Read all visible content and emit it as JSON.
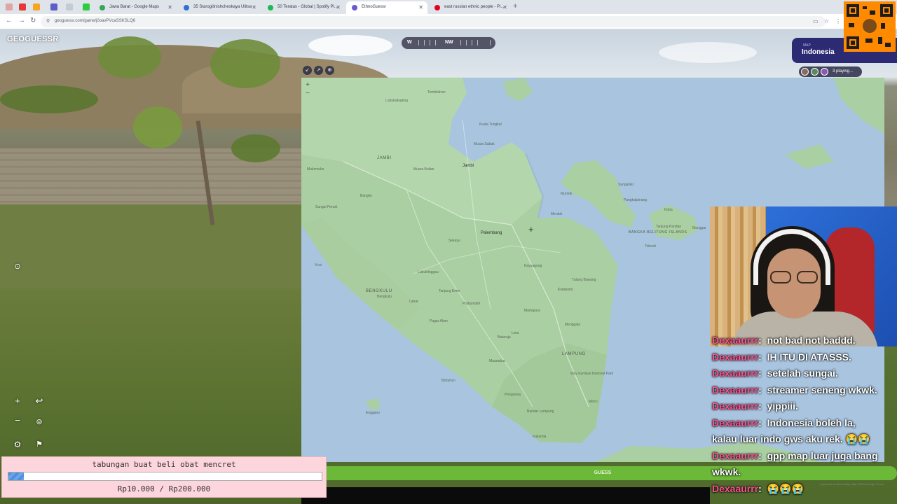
{
  "browser": {
    "tabs": [
      {
        "title": "Jawa Barat - Google Maps",
        "active": false,
        "color": "#34a853"
      },
      {
        "title": "35 Starogilinishcheskaya Ulitsa",
        "active": false,
        "color": "#2f6fd6"
      },
      {
        "title": "50 Teratas - Global | Spotify Pl...",
        "active": false,
        "color": "#1db954"
      },
      {
        "title": "EthnoGuessr",
        "active": true,
        "color": "#6a5acd"
      },
      {
        "title": "east russian ethnic people - Pi...",
        "active": false,
        "color": "#e60023"
      }
    ],
    "url": "geoguessr.com/game/j0oavPVcaSSKSLQ6",
    "new_tab_icon": "plus-icon"
  },
  "game": {
    "logo": "GEOGUESSR",
    "compass": {
      "left_label": "W",
      "heading": "NW"
    },
    "map_info": {
      "label": "MAP",
      "name": "Indonesia"
    },
    "players_text": "3 playing...",
    "guess_button": "GUESS",
    "attribution": "Keyboard shortcuts   Map data ©2024 Google   Terms"
  },
  "map": {
    "labels": {
      "jambi_region": "JAMBI",
      "bengkulu_region": "BENGKULU",
      "lampung_region": "LAMPUNG",
      "bangka_region": "BANGKA BELITUNG ISLANDS",
      "jambi": "Jambi",
      "tembilahan": "Tembilahan",
      "muara_bulian": "Muara Bulian",
      "bangko": "Bangko",
      "sungai_penuh": "Sungai Penuh",
      "lubuklinggau": "Lubuklinggau",
      "palembang": "Palembang",
      "sekayu": "Sekayu",
      "kayuagung": "Kayuagung",
      "lahat": "Lahat",
      "prabumulih": "Prabumulih",
      "pagar_alam": "Pagar Alam",
      "baturaja": "Baturaja",
      "bengkulu": "Bengkulu",
      "kotabumi": "Kotabumi",
      "metro": "Metro",
      "bandar_lampung": "Bandar Lampung",
      "kalianda": "Kalianda",
      "muntok": "Muntok",
      "pangkalpinang": "Pangkalpinang",
      "koba": "Koba",
      "toboali": "Toboali",
      "tanjung_pandan": "Tanjung Pandan",
      "manggar": "Manggar",
      "sungailiat": "Sungailiat",
      "krui": "Krui",
      "way_kambas": "Way Kambas National Park",
      "enggano": "Enggano",
      "muara_sabak": "Muara Sabak",
      "kuala_tungkal": "Kuala Tungkal",
      "mukomuko": "Mukomuko",
      "lubuk_sikaping": "Lubuksikaping",
      "bintuhan": "Bintuhan",
      "liwa": "Liwa",
      "menggala": "Menggala",
      "tulang_bawang": "Tulang Bawang",
      "pringsewu": "Pringsewu",
      "martapura": "Martapura",
      "muaradua": "Muaradua",
      "tanjung": "Tanjung Enim",
      "mentok": "Mentok"
    }
  },
  "chat": [
    {
      "user": "Dexaaurrr",
      "text": "not bad not baddd."
    },
    {
      "user": "Dexaaurrr",
      "text": "IH ITU DI ATASSS."
    },
    {
      "user": "Dexaaurrr",
      "text": "setelah sungai."
    },
    {
      "user": "Dexaaurrr",
      "text": "streamer seneng wkwk."
    },
    {
      "user": "Dexaaurrr",
      "text": "yippiii."
    },
    {
      "user": "Dexaaurrr",
      "text": "Indonesia boleh la,"
    },
    {
      "user": "",
      "text": "kalau luar indo gws aku rek. 😭😭"
    },
    {
      "user": "Dexaaurrr",
      "text": "gpp map luar juga bang"
    },
    {
      "user": "",
      "text": "wkwk."
    },
    {
      "user": "Dexaaurrr",
      "text": "😭😭😭"
    }
  ],
  "goal": {
    "title": "tabungan buat beli obat mencret",
    "amount_text": "Rp10.000 / Rp200.000",
    "progress": 0.05
  },
  "colors": {
    "accent_guess": "#6cb838",
    "chat_user": "#ff4f8f",
    "goal_bg": "#fdd5dc"
  }
}
